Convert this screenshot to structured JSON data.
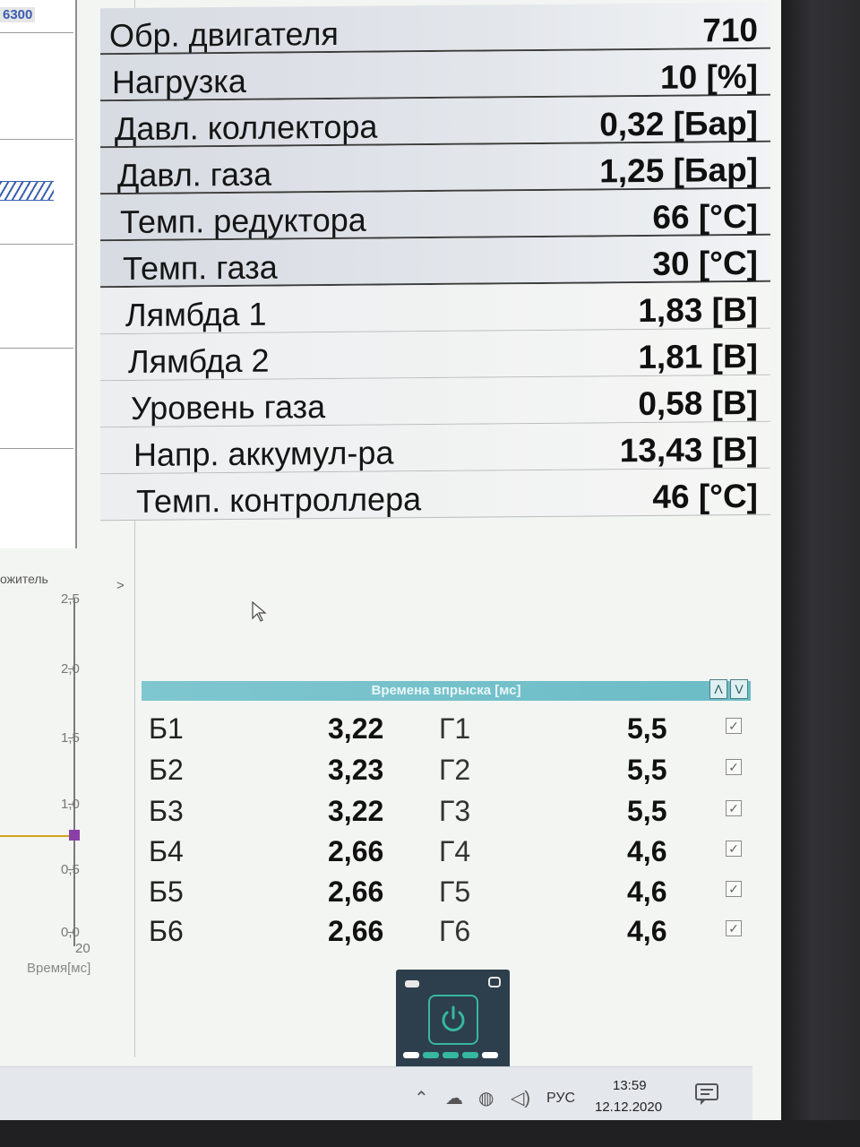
{
  "left_chart": {
    "corner_label": "6300",
    "axis_title": "ожитель",
    "y_ticks": [
      "2,5",
      "2,0",
      "1,5",
      "1,0",
      "0,5",
      "0,0"
    ],
    "x_tick": "20",
    "x_title": "Время[мс]",
    "expand_glyph": ">"
  },
  "parameters": [
    {
      "name": "Обр. двигателя",
      "value": "710"
    },
    {
      "name": "Нагрузка",
      "value": "10 [%]"
    },
    {
      "name": "Давл. коллектора",
      "value": "0,32 [Бар]"
    },
    {
      "name": "Давл. газа",
      "value": "1,25 [Бар]"
    },
    {
      "name": "Темп. редуктора",
      "value": "66 [°C]"
    },
    {
      "name": "Темп. газа",
      "value": "30 [°C]"
    },
    {
      "name": "Лямбда 1",
      "value": "1,83 [В]"
    },
    {
      "name": "Лямбда 2",
      "value": "1,81 [В]"
    },
    {
      "name": "Уровень газа",
      "value": "0,58 [В]"
    },
    {
      "name": "Напр. аккумул-ра",
      "value": "13,43 [В]"
    },
    {
      "name": "Темп. контроллера",
      "value": "46 [°C]"
    }
  ],
  "injection": {
    "title": "Времена впрыска [мс]",
    "up_label": "Λ",
    "down_label": "V",
    "rows": [
      {
        "b_label": "Б1",
        "b_value": "3,22",
        "g_label": "Г1",
        "g_value": "5,5",
        "checked": true
      },
      {
        "b_label": "Б2",
        "b_value": "3,23",
        "g_label": "Г2",
        "g_value": "5,5",
        "checked": true
      },
      {
        "b_label": "Б3",
        "b_value": "3,22",
        "g_label": "Г3",
        "g_value": "5,5",
        "checked": true
      },
      {
        "b_label": "Б4",
        "b_value": "2,66",
        "g_label": "Г4",
        "g_value": "4,6",
        "checked": true
      },
      {
        "b_label": "Б5",
        "b_value": "2,66",
        "g_label": "Г5",
        "g_value": "4,6",
        "checked": true
      },
      {
        "b_label": "Б6",
        "b_value": "2,66",
        "g_label": "Г6",
        "g_value": "4,6",
        "checked": true
      }
    ]
  },
  "taskbar": {
    "language": "РУС",
    "time": "13:59",
    "date": "12.12.2020"
  },
  "colors": {
    "accent_teal": "#35b8a0",
    "header_teal": "#7fc6cf",
    "series_line": "#d1a31a",
    "series_marker": "#8a3fa8"
  }
}
